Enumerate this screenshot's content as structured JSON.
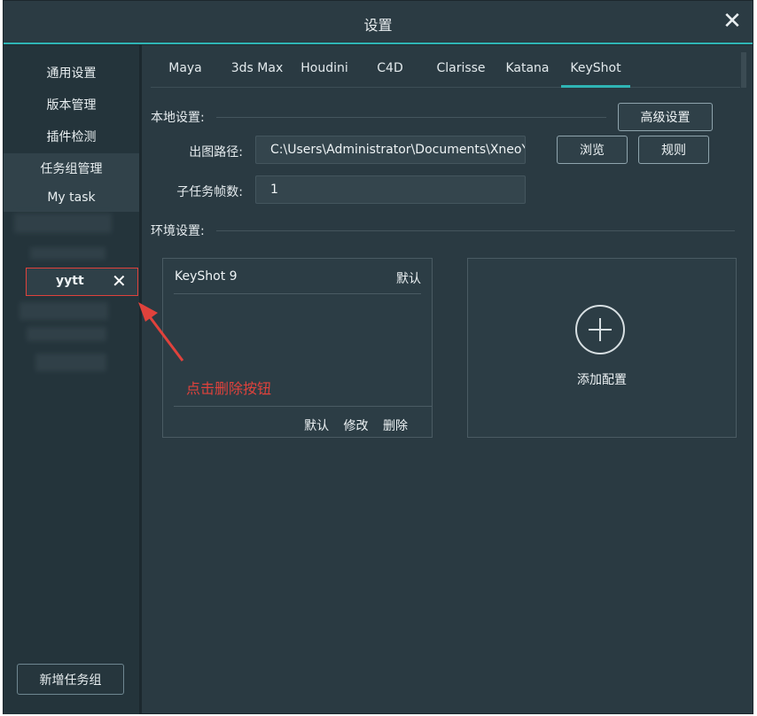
{
  "window": {
    "title": "设置",
    "close_icon": "✕"
  },
  "sidebar": {
    "items": [
      {
        "label": "通用设置"
      },
      {
        "label": "版本管理"
      },
      {
        "label": "插件检测"
      },
      {
        "label": "任务组管理"
      },
      {
        "label": "My task"
      }
    ],
    "selected_group": {
      "label": "yytt",
      "delete_icon": "✕"
    },
    "add_group_label": "新增任务组"
  },
  "tabs": [
    "Maya",
    "3ds Max",
    "Houdini",
    "C4D",
    "Clarisse",
    "Katana",
    "KeyShot"
  ],
  "active_tab": "KeyShot",
  "local_settings": {
    "label": "本地设置:",
    "advanced_button": "高级设置",
    "output_path_label": "出图路径:",
    "output_path_value": "C:\\Users\\Administrator\\Documents\\XneoY",
    "browse_button": "浏览",
    "rules_button": "规则",
    "subtask_frames_label": "子任务帧数:",
    "subtask_frames_value": "1"
  },
  "env_settings": {
    "label": "环境设置:",
    "config_card": {
      "name": "KeyShot 9",
      "default_tag": "默认",
      "actions": [
        "默认",
        "修改",
        "删除"
      ]
    },
    "add_config_label": "添加配置"
  },
  "annotation": {
    "text": "点击删除按钮",
    "color": "#e0423c"
  },
  "colors": {
    "accent": "#2fb5b5",
    "background": "#2a3a42"
  }
}
